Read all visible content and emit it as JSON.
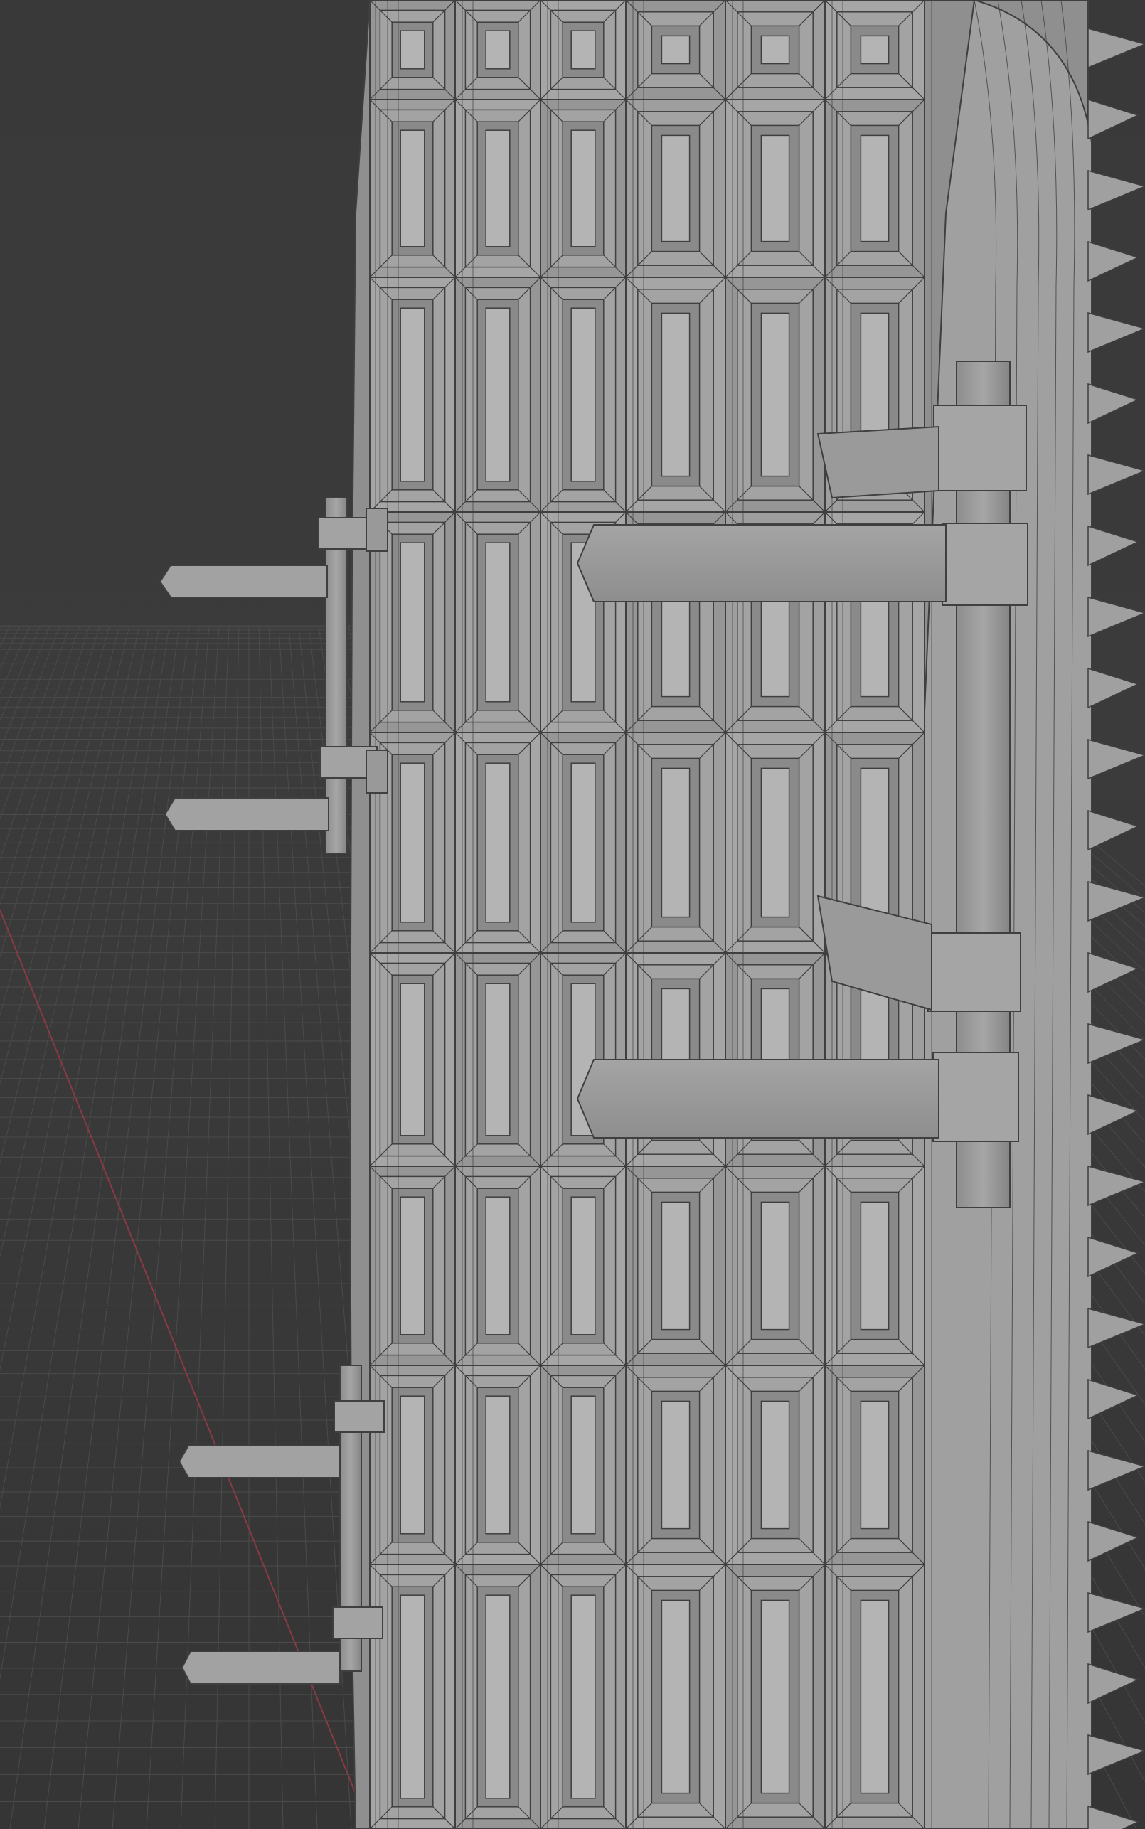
{
  "viewport": {
    "kind": "3d-viewport",
    "shading": "solid-wireframe",
    "object": "gate",
    "background_color": "#3a3a3a",
    "grid_color": "#4b4b4b",
    "x_axis_color": "#8a3a44",
    "mesh_color": "#9c9c9c",
    "wire_color": "#3f3f3f"
  }
}
